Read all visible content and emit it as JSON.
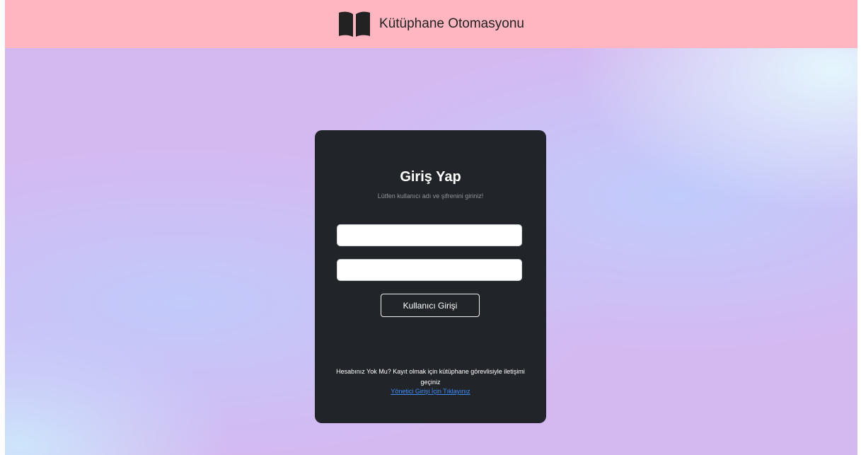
{
  "navbar": {
    "brand_text": "Kütüphane Otomasyonu",
    "brand_icon": "open-book-icon",
    "background_color": "#ffb6c1"
  },
  "login_card": {
    "title": "Giriş Yap",
    "subtitle": "Lütfen kullanıcı adı ve şifrenini giriniz!",
    "username_value": "",
    "password_value": "",
    "submit_label": "Kullanıcı Girişi",
    "no_account_text": "Hesabınız Yok Mu? Kayıt olmak için kütüphane görevlisiyle iletişimi geçiniz",
    "admin_link_text": "Yönetici Girişi İçin Tıklayınız",
    "background_color": "#212529",
    "link_color": "#3d8bfd"
  }
}
